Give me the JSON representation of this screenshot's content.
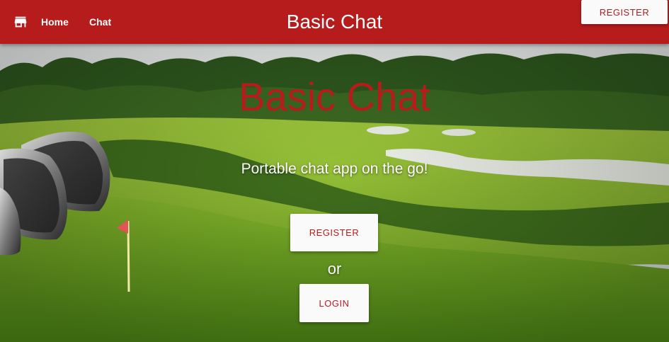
{
  "navbar": {
    "brand_icon": "store-icon",
    "links": [
      {
        "label": "Home"
      },
      {
        "label": "Chat"
      }
    ],
    "title": "Basic Chat",
    "register_label": "REGISTER"
  },
  "hero": {
    "title": "Basic Chat",
    "subtitle": "Portable chat app on the go!",
    "register_label": "REGISTER",
    "or_label": "or",
    "login_label": "LOGIN"
  },
  "colors": {
    "primary": "#b71c1c",
    "button_bg": "#fafafa",
    "text_on_primary": "#ffffff"
  }
}
